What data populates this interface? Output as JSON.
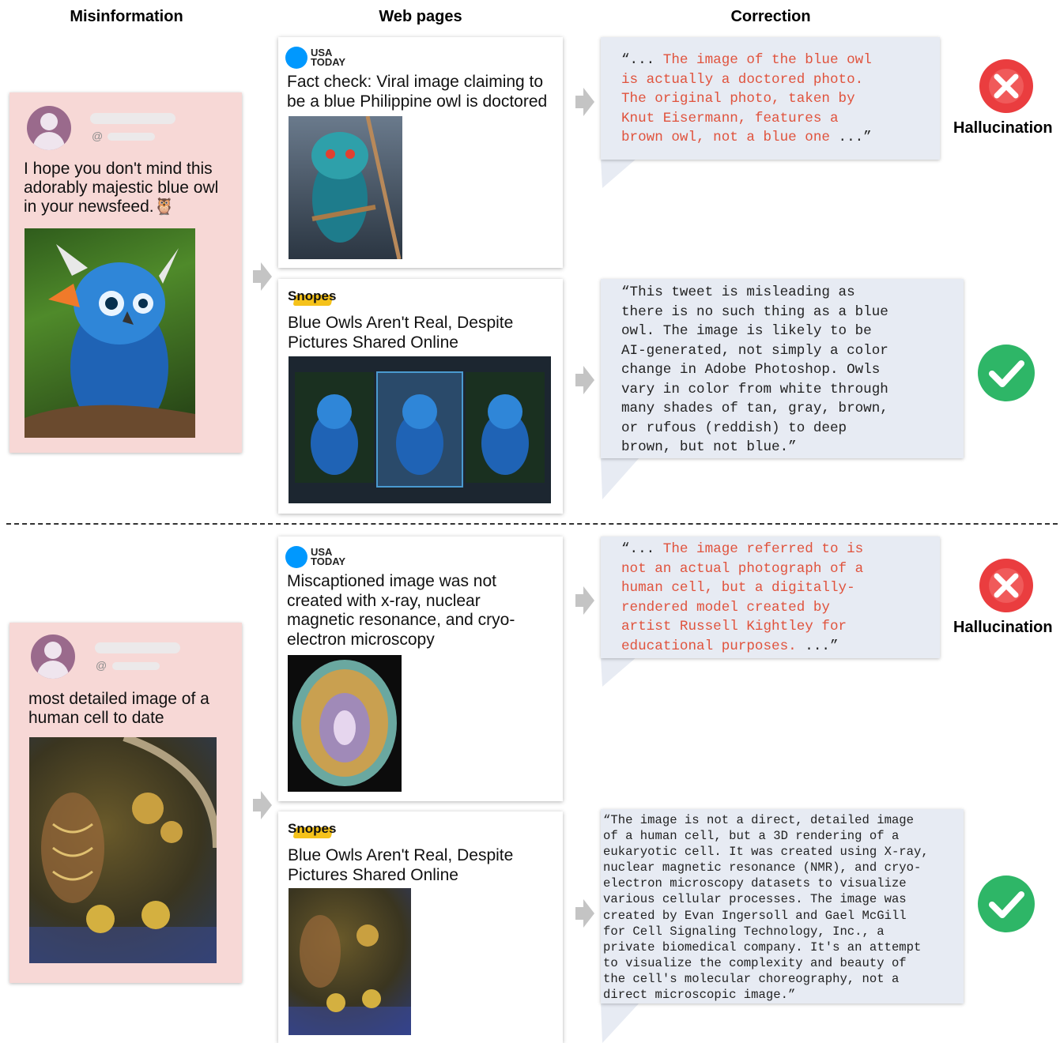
{
  "headers": {
    "misinformation": "Misinformation",
    "web_pages": "Web pages",
    "correction": "Correction"
  },
  "colors": {
    "post_bg": "#f7d8d6",
    "bubble_bg": "#e7ebf3",
    "hallucination_red": "#e0533d",
    "error_icon": "#ea3d3f",
    "check_icon": "#2eb667"
  },
  "examples": [
    {
      "post": {
        "handle_prefix": "@",
        "text": "I hope you don't mind this adorably majestic blue owl in your newsfeed.",
        "emoji": "🦉"
      },
      "web_pages": [
        {
          "source": "USA TODAY",
          "source_line1": "USA",
          "source_line2": "TODAY",
          "title": "Fact check: Viral image claiming to be a blue Philippine owl is doctored"
        },
        {
          "source": "Snopes",
          "title": "Blue Owls Aren't Real, Despite Pictures Shared Online"
        }
      ],
      "corrections": [
        {
          "open": "“... ",
          "body": "The image of the blue owl\nis actually a doctored photo.\nThe original photo, taken by\nKnut Eisermann, features a\nbrown owl, not a blue one",
          "close": " ...”",
          "verdict": "Hallucination",
          "icon": "cross-icon"
        },
        {
          "body": "“This tweet is misleading as\nthere is no such thing as a blue\nowl. The image is likely to be\nAI-generated, not simply a color\nchange in Adobe Photoshop. Owls\nvary in color from white through\nmany shades of tan, gray, brown,\nor rufous (reddish) to deep\nbrown, but not blue.”",
          "verdict": "",
          "icon": "check-icon"
        }
      ]
    },
    {
      "post": {
        "handle_prefix": "@",
        "text": "most detailed image of a human cell to date"
      },
      "web_pages": [
        {
          "source": "USA TODAY",
          "source_line1": "USA",
          "source_line2": "TODAY",
          "title": "Miscaptioned image was not created with x-ray, nuclear magnetic resonance, and cryo-electron microscopy"
        },
        {
          "source": "Snopes",
          "title": "Blue Owls Aren't Real, Despite Pictures Shared Online"
        }
      ],
      "corrections": [
        {
          "open": "“... ",
          "body": "The image referred to is\nnot an actual photograph of a\nhuman cell, but a digitally-\nrendered model created by\nartist Russell Kightley for\neducational purposes.",
          "close": " ...”",
          "verdict": "Hallucination",
          "icon": "cross-icon"
        },
        {
          "body": "“The image is not a direct, detailed image\nof a human cell, but a 3D rendering of a\neukaryotic cell. It was created using X-ray,\nnuclear magnetic resonance (NMR), and cryo-\nelectron microscopy datasets to visualize\nvarious cellular processes. The image was\ncreated by Evan Ingersoll and Gael McGill\nfor Cell Signaling Technology, Inc., a\nprivate biomedical company. It's an attempt\nto visualize the complexity and beauty of\nthe cell's molecular choreography, not a\ndirect microscopic image.”",
          "verdict": "",
          "icon": "check-icon"
        }
      ]
    }
  ]
}
